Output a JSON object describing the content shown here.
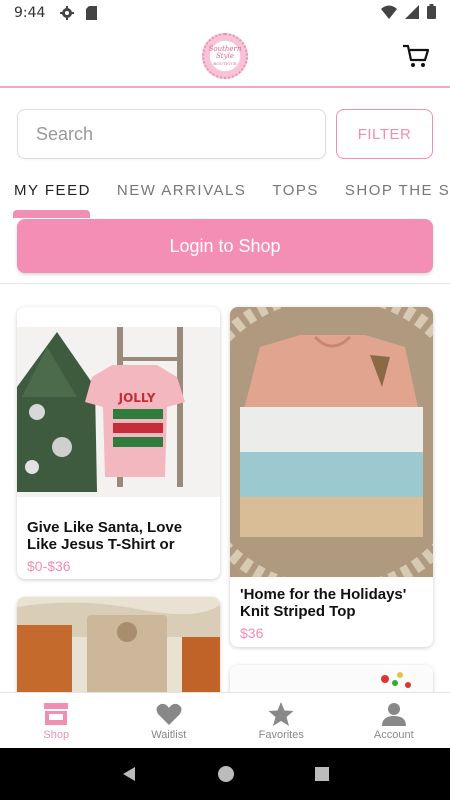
{
  "status_bar": {
    "time": "9:44"
  },
  "header": {
    "logo_text": "Southern Style",
    "logo_subtext": "BOUTIQUE"
  },
  "search": {
    "placeholder": "Search",
    "filter_label": "FILTER"
  },
  "tabs": [
    {
      "label": "MY FEED",
      "active": true
    },
    {
      "label": "NEW ARRIVALS",
      "active": false
    },
    {
      "label": "TOPS",
      "active": false
    },
    {
      "label": "SHOP THE ST",
      "active": false
    }
  ],
  "login": {
    "label": "Login to Shop"
  },
  "products": [
    {
      "title": "Give Like Santa, Love Like Jesus T-Shirt or",
      "price": "$0-$36",
      "shirt_text": "JOLLY"
    },
    {
      "title": "'Home for the Holidays' Knit Striped Top",
      "price": "$36"
    }
  ],
  "bottom_nav": [
    {
      "label": "Shop",
      "icon": "shop-icon",
      "active": true
    },
    {
      "label": "Waitlist",
      "icon": "heart-icon",
      "active": false
    },
    {
      "label": "Favorites",
      "icon": "star-icon",
      "active": false
    },
    {
      "label": "Account",
      "icon": "account-icon",
      "active": false
    }
  ],
  "colors": {
    "accent": "#f28db4",
    "login_bg": "#f58eb5",
    "price": "#f28db4"
  }
}
